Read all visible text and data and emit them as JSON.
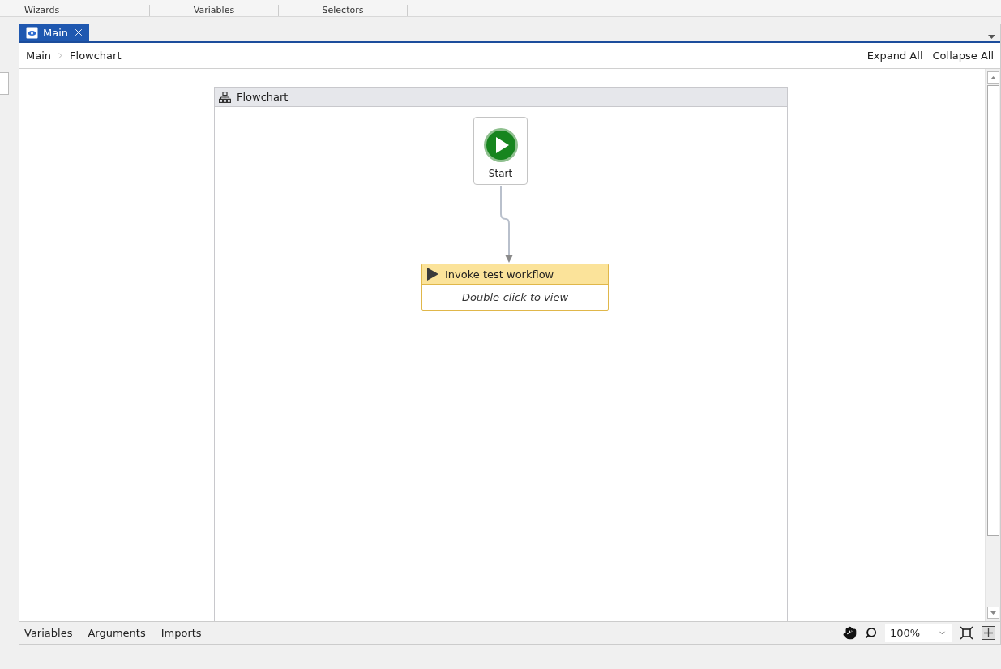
{
  "top_tabs": [
    "Wizards",
    "Variables",
    "Selectors"
  ],
  "document_tabs": [
    {
      "label": "Main",
      "selected": true
    }
  ],
  "breadcrumb": [
    "Main",
    "Flowchart"
  ],
  "header_actions": [
    "Expand All",
    "Collapse All"
  ],
  "flowchart": {
    "title": "Flowchart",
    "nodes": [
      {
        "kind": "start",
        "label": "Start"
      },
      {
        "kind": "activity",
        "title": "Invoke test workflow",
        "hint": "Double-click to view"
      }
    ]
  },
  "bottom_tabs": [
    "Variables",
    "Arguments",
    "Imports"
  ],
  "zoom": {
    "value": "100%"
  }
}
